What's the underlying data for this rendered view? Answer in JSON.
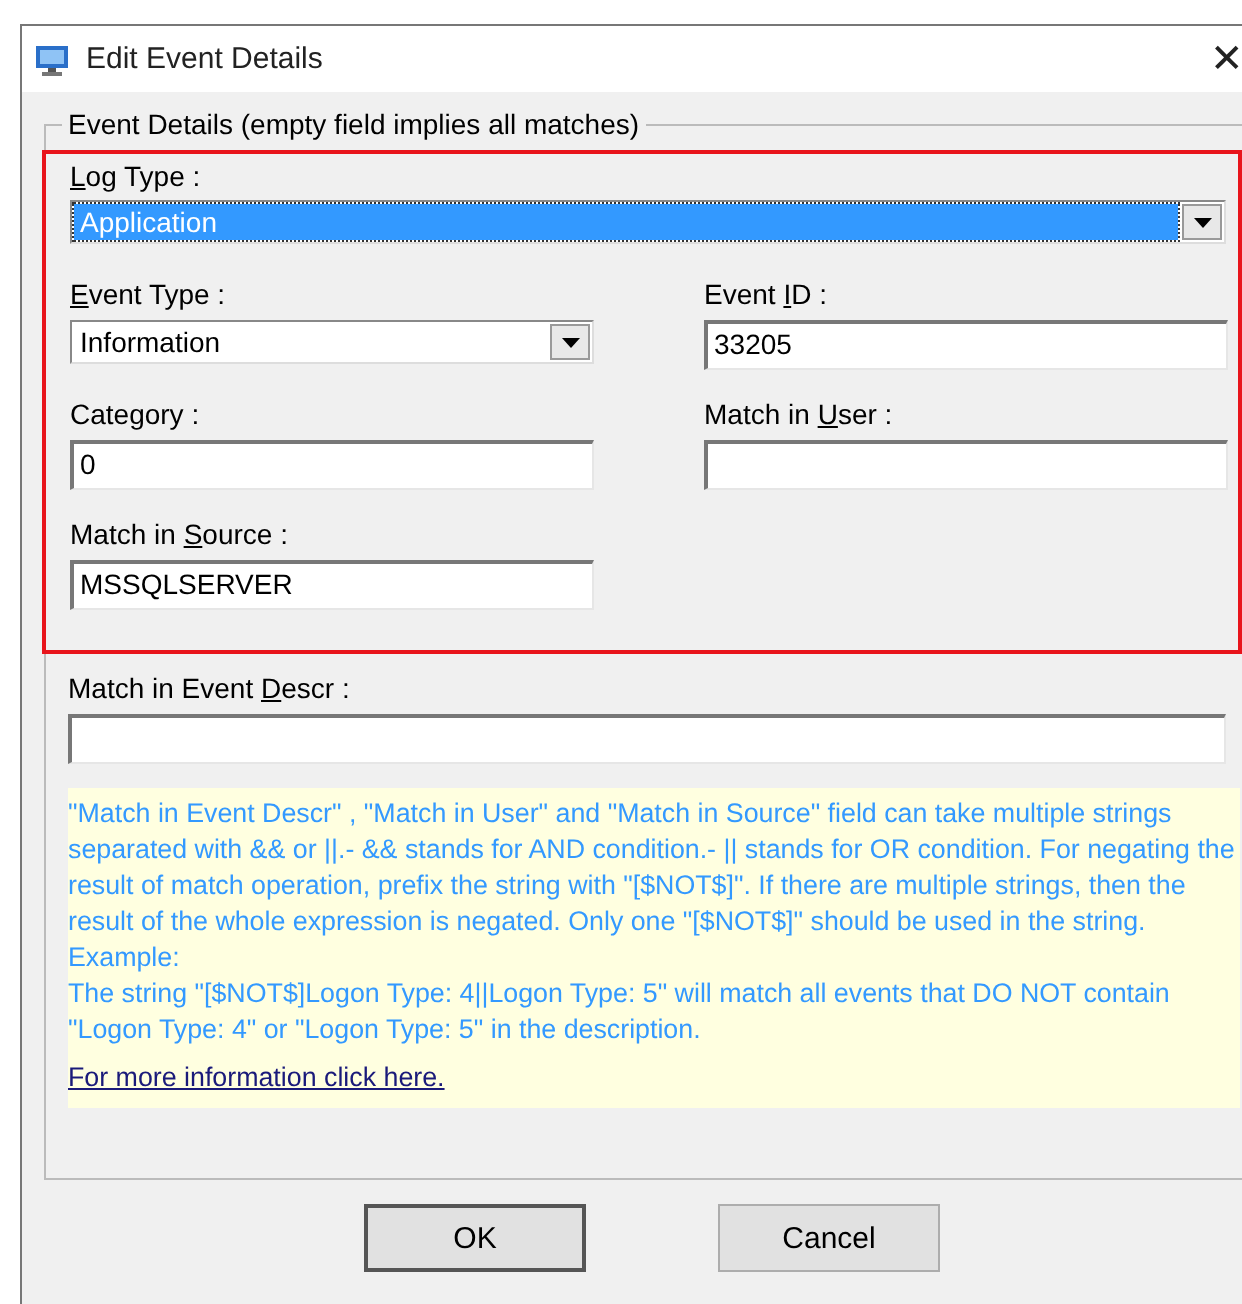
{
  "window": {
    "title": "Edit Event Details",
    "close": "✕"
  },
  "group": {
    "title": "Event Details (empty field implies all matches)"
  },
  "highlight": {
    "on": true
  },
  "log_type": {
    "label": {
      "key": "L",
      "after": "og Type :"
    },
    "value": "Application",
    "focused": true
  },
  "fields": [
    {
      "kind": "dropdown",
      "label": {
        "key": "E",
        "after": "vent Type :"
      },
      "value": "Information"
    },
    {
      "kind": "text",
      "label": {
        "before": "Event ",
        "key": "I",
        "after": "D :"
      },
      "value": "33205"
    },
    {
      "kind": "text",
      "label": {
        "after": "Category :"
      },
      "value": "0"
    },
    {
      "kind": "text",
      "label": {
        "before": "Match in ",
        "key": "U",
        "after": "ser :"
      }
    },
    {
      "kind": "text",
      "label": {
        "before": "Match in ",
        "key": "S",
        "after": "ource :"
      },
      "value": "MSSQLSERVER"
    }
  ],
  "descr": {
    "label": {
      "before": "Match in Event ",
      "key": "D",
      "after": "escr :"
    }
  },
  "help": {
    "lines": [
      "\"Match in Event Descr\" , \"Match in User\" and \"Match in Source\" field can take multiple strings separated with && or ||.- && stands for AND condition.- || stands for OR condition. For negating the result of match operation, prefix the string with \"[$NOT$]\". If there are multiple strings, then the result of the whole expression is negated. Only one \"[$NOT$]\" should be used in the string.",
      "Example:",
      "The string \"[$NOT$]Logon Type: 4||Logon Type: 5\" will match all events that DO NOT contain \"Logon Type: 4\" or \"Logon Type: 5\" in the description."
    ],
    "link": "For more information click here."
  },
  "buttons": [
    "OK",
    "Cancel"
  ]
}
